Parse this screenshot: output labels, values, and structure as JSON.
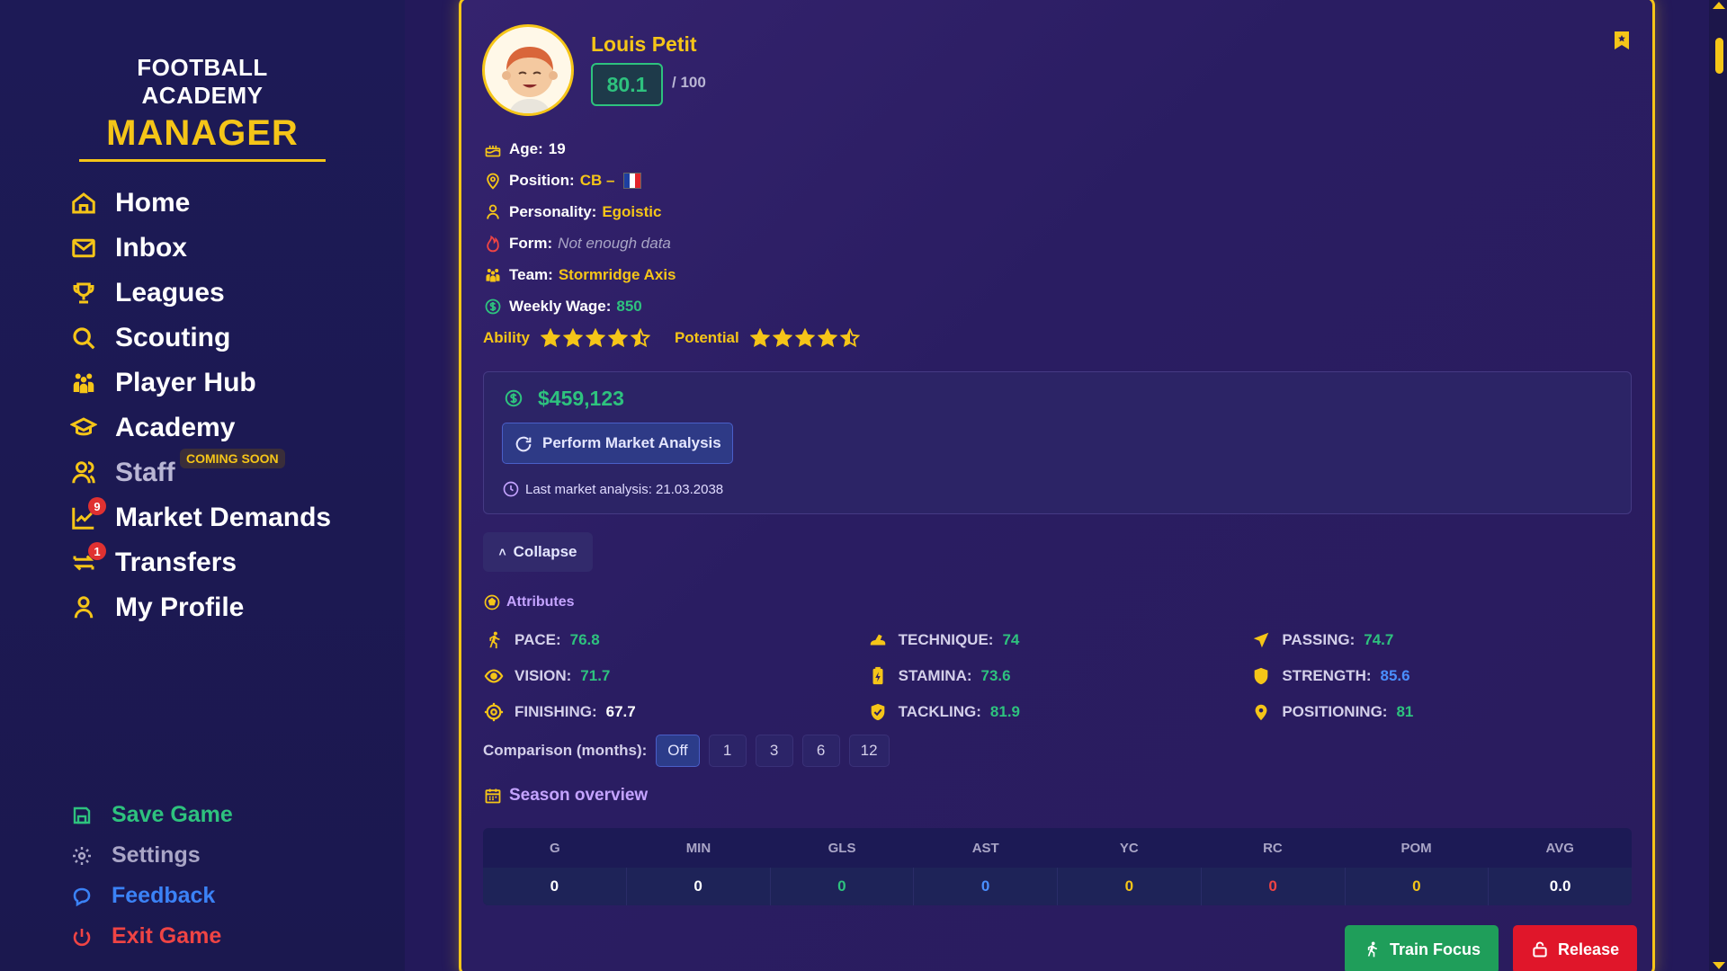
{
  "logo": {
    "line1": "FOOTBALL ACADEMY",
    "line2": "MANAGER"
  },
  "nav": {
    "items": [
      {
        "label": "Home"
      },
      {
        "label": "Inbox"
      },
      {
        "label": "Leagues"
      },
      {
        "label": "Scouting"
      },
      {
        "label": "Player Hub"
      },
      {
        "label": "Academy"
      },
      {
        "label": "Staff",
        "tag": "COMING SOON"
      },
      {
        "label": "Market Demands",
        "badge": "9"
      },
      {
        "label": "Transfers",
        "badge": "1"
      },
      {
        "label": "My Profile"
      }
    ],
    "bottom": [
      {
        "label": "Save Game",
        "color": "#2ec27e"
      },
      {
        "label": "Settings",
        "color": "#a9a5c6"
      },
      {
        "label": "Feedback",
        "color": "#3b82f6"
      },
      {
        "label": "Exit Game",
        "color": "#ef4444"
      }
    ]
  },
  "player": {
    "name": "Louis Petit",
    "rating": "80.1",
    "rating_max": "/ 100",
    "age_label": "Age:",
    "age": "19",
    "position_label": "Position:",
    "position": "CB –",
    "personality_label": "Personality:",
    "personality": "Egoistic",
    "form_label": "Form:",
    "form": "Not enough data",
    "team_label": "Team:",
    "team": "Stormridge Axis",
    "wage_label": "Weekly Wage:",
    "wage": "850",
    "ability_label": "Ability",
    "ability_stars": 4.5,
    "potential_label": "Potential",
    "potential_stars": 4.5
  },
  "market": {
    "value": "$459,123",
    "analysis_button": "Perform Market Analysis",
    "last_analysis": "Last market analysis: 21.03.2038"
  },
  "collapse_label": "Collapse",
  "attributes": {
    "title": "Attributes",
    "items": [
      {
        "name": "PACE:",
        "value": "76.8",
        "icon": "running-icon"
      },
      {
        "name": "TECHNIQUE:",
        "value": "74",
        "icon": "boot-icon"
      },
      {
        "name": "PASSING:",
        "value": "74.7",
        "icon": "send-icon"
      },
      {
        "name": "VISION:",
        "value": "71.7",
        "icon": "eye-icon"
      },
      {
        "name": "STAMINA:",
        "value": "73.6",
        "icon": "battery-icon"
      },
      {
        "name": "STRENGTH:",
        "value": "85.6",
        "icon": "shield-icon"
      },
      {
        "name": "FINISHING:",
        "value": "67.7",
        "icon": "crosshair-icon"
      },
      {
        "name": "TACKLING:",
        "value": "81.9",
        "icon": "shield-check-icon"
      },
      {
        "name": "POSITIONING:",
        "value": "81",
        "icon": "map-pin-icon"
      }
    ]
  },
  "comparison": {
    "label": "Comparison (months):",
    "options": [
      "Off",
      "1",
      "3",
      "6",
      "12"
    ],
    "selected": "Off"
  },
  "season": {
    "title": "Season overview",
    "headers": [
      "G",
      "MIN",
      "GLS",
      "AST",
      "YC",
      "RC",
      "POM",
      "AVG"
    ],
    "values": [
      "0",
      "0",
      "0",
      "0",
      "0",
      "0",
      "0",
      "0.0"
    ],
    "colors": [
      "#ffffff",
      "#ffffff",
      "#2ec27e",
      "#4a8fff",
      "#f5c518",
      "#ef4444",
      "#f5c518",
      "#ffffff"
    ]
  },
  "actions": {
    "train": "Train Focus",
    "release": "Release"
  },
  "colors": {
    "accent": "#f5c518",
    "green": "#2ec27e",
    "red": "#e0162a"
  }
}
